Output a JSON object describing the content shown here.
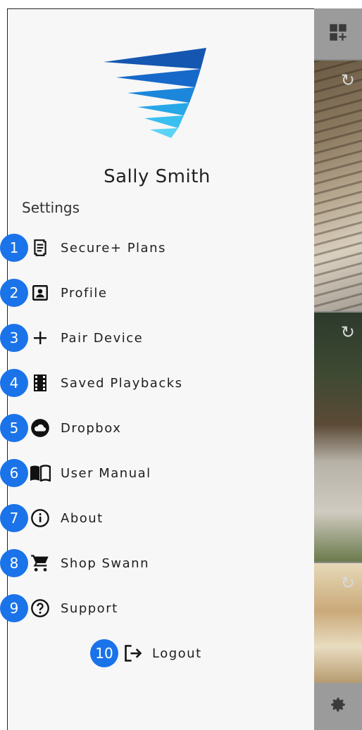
{
  "drawer": {
    "user_name": "Sally Smith",
    "section_title": "Settings",
    "items": [
      {
        "badge": "1",
        "label": "Secure+ Plans",
        "icon": "receipt-icon"
      },
      {
        "badge": "2",
        "label": "Profile",
        "icon": "contact-card-icon"
      },
      {
        "badge": "3",
        "label": "Pair Device",
        "icon": "plus-icon"
      },
      {
        "badge": "4",
        "label": "Saved Playbacks",
        "icon": "film-icon"
      },
      {
        "badge": "5",
        "label": "Dropbox",
        "icon": "cloud-icon"
      },
      {
        "badge": "6",
        "label": "User Manual",
        "icon": "book-icon"
      },
      {
        "badge": "7",
        "label": "About",
        "icon": "info-icon"
      },
      {
        "badge": "8",
        "label": "Shop Swann",
        "icon": "cart-icon"
      },
      {
        "badge": "9",
        "label": "Support",
        "icon": "help-icon"
      }
    ],
    "logout": {
      "badge": "10",
      "label": "Logout",
      "icon": "logout-icon"
    }
  },
  "colors": {
    "badge": "#1a73e8",
    "logo_dark": "#1a5fb4",
    "logo_light": "#5ad3f5"
  }
}
